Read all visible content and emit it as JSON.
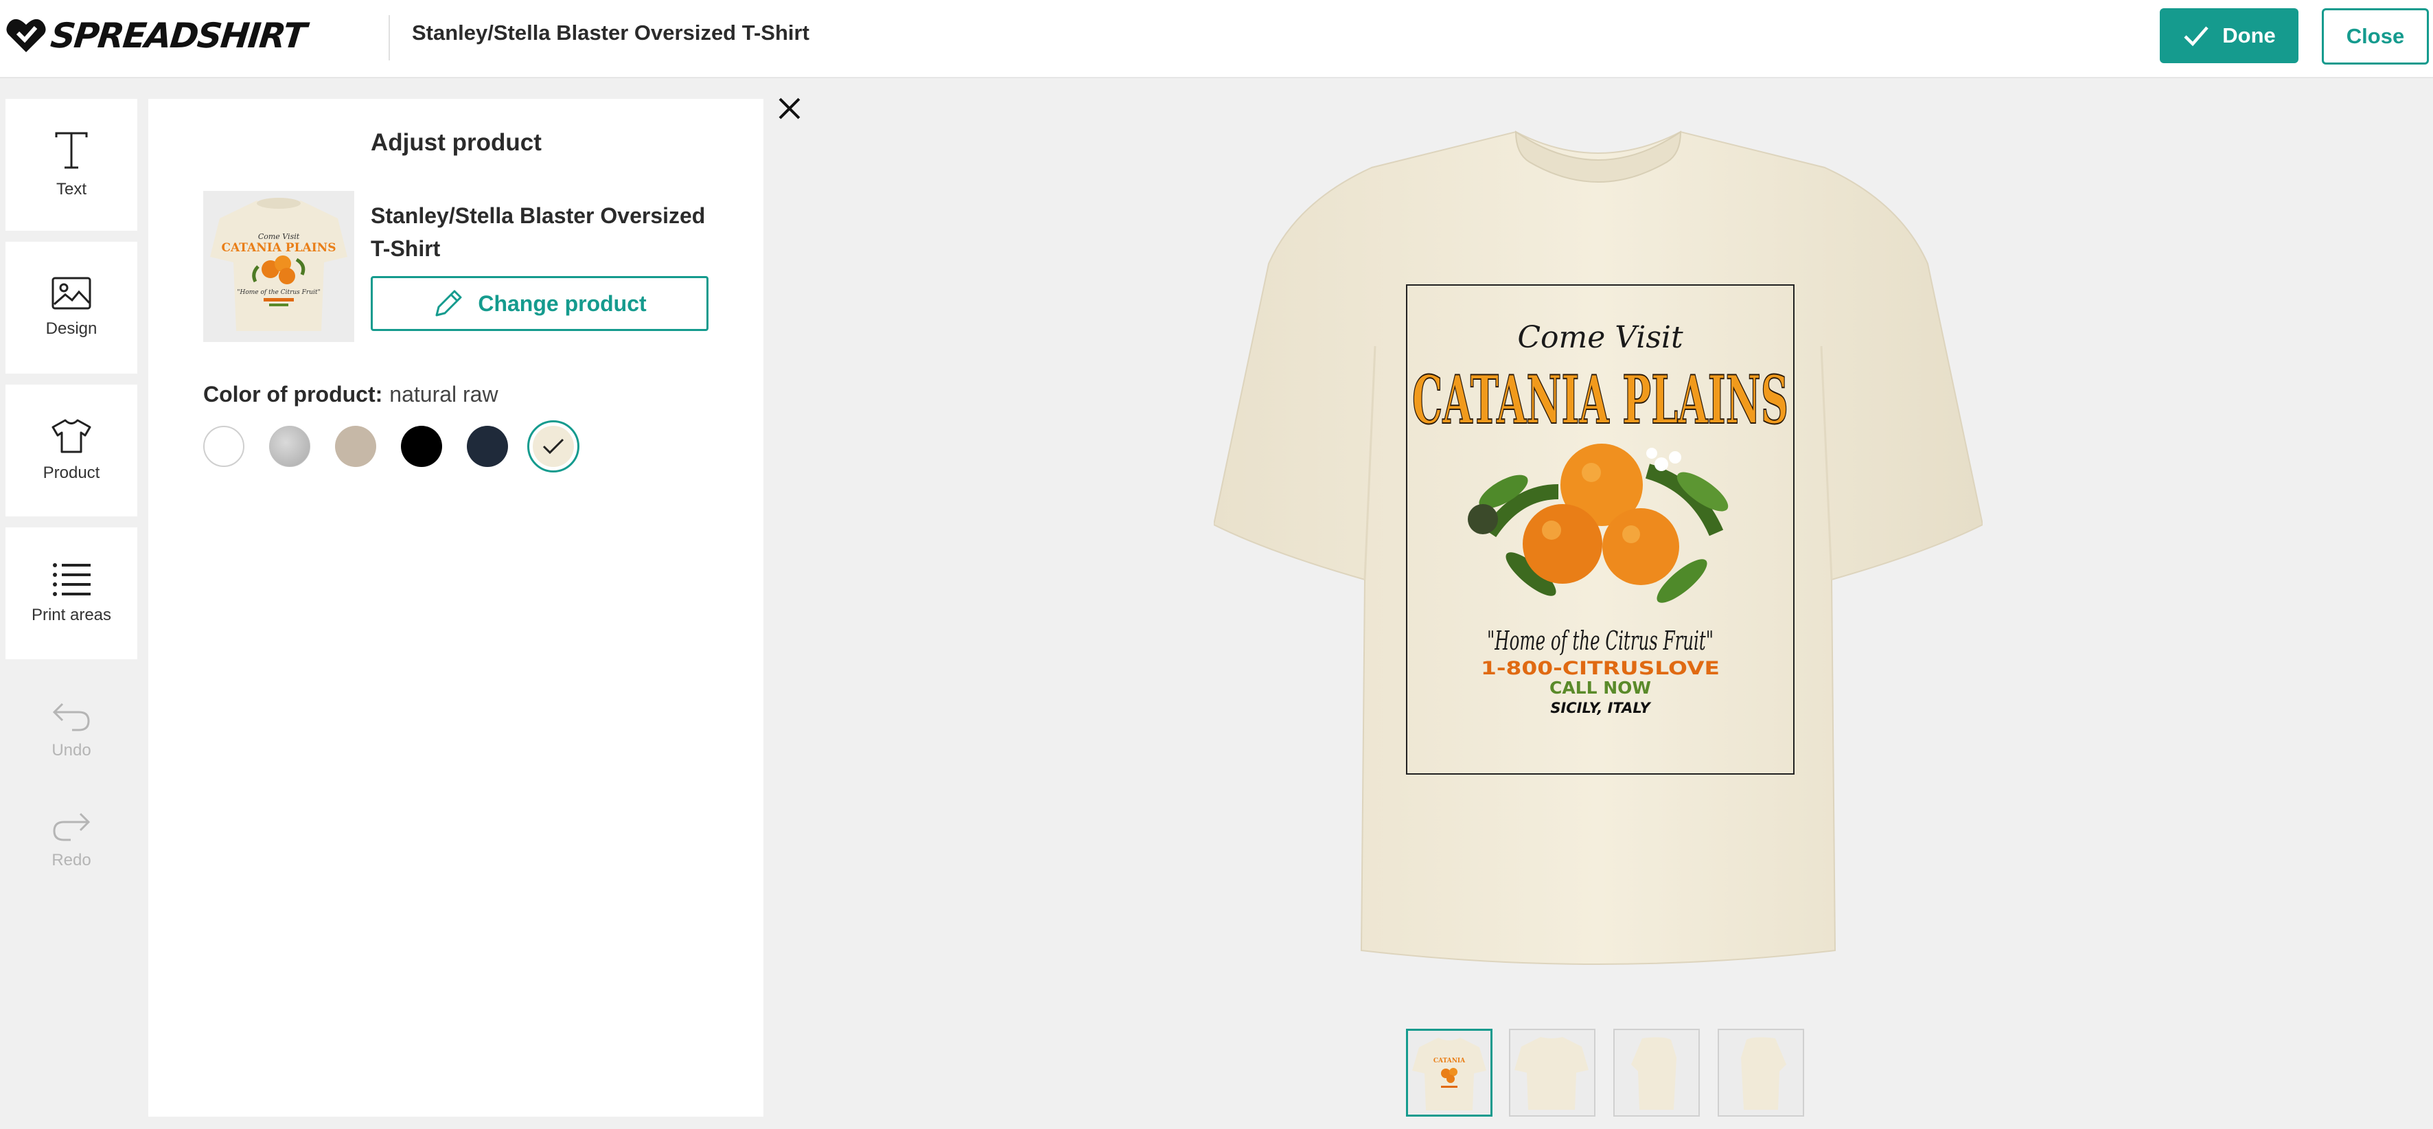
{
  "header": {
    "brand": "SPREADSHIRT",
    "title": "Stanley/Stella Blaster Oversized T-Shirt",
    "done_label": "Done",
    "close_label": "Close"
  },
  "toolbar": {
    "items": [
      {
        "label": "Text",
        "icon": "text-icon"
      },
      {
        "label": "Design",
        "icon": "image-icon"
      },
      {
        "label": "Product",
        "icon": "tshirt-icon"
      },
      {
        "label": "Print areas",
        "icon": "list-icon"
      }
    ],
    "undo_label": "Undo",
    "redo_label": "Redo"
  },
  "panel": {
    "title": "Adjust product",
    "product_name": "Stanley/Stella Blaster Oversized T-Shirt",
    "change_label": "Change product",
    "color_label": "Color of product:",
    "color_value": "natural raw",
    "swatches": [
      {
        "name": "white",
        "color": "#ffffff"
      },
      {
        "name": "heather grey",
        "color": "#bdbdbd"
      },
      {
        "name": "beige",
        "color": "#c6b8a7"
      },
      {
        "name": "black",
        "color": "#000000"
      },
      {
        "name": "navy",
        "color": "#1f2a3a"
      },
      {
        "name": "natural raw",
        "color": "#f1ead8",
        "selected": true
      }
    ]
  },
  "design": {
    "line1": "Come Visit",
    "line2": "CATANIA PLAINS",
    "line3": "\"Home of the Citrus Fruit\"",
    "line4": "1-800-CITRUSLOVE",
    "line5": "CALL NOW",
    "line6": "SICILY, ITALY"
  },
  "colors": {
    "accent": "#159b8e",
    "shirt": "#f1ead8",
    "orange": "#e97e17",
    "green": "#5a8a2a"
  }
}
